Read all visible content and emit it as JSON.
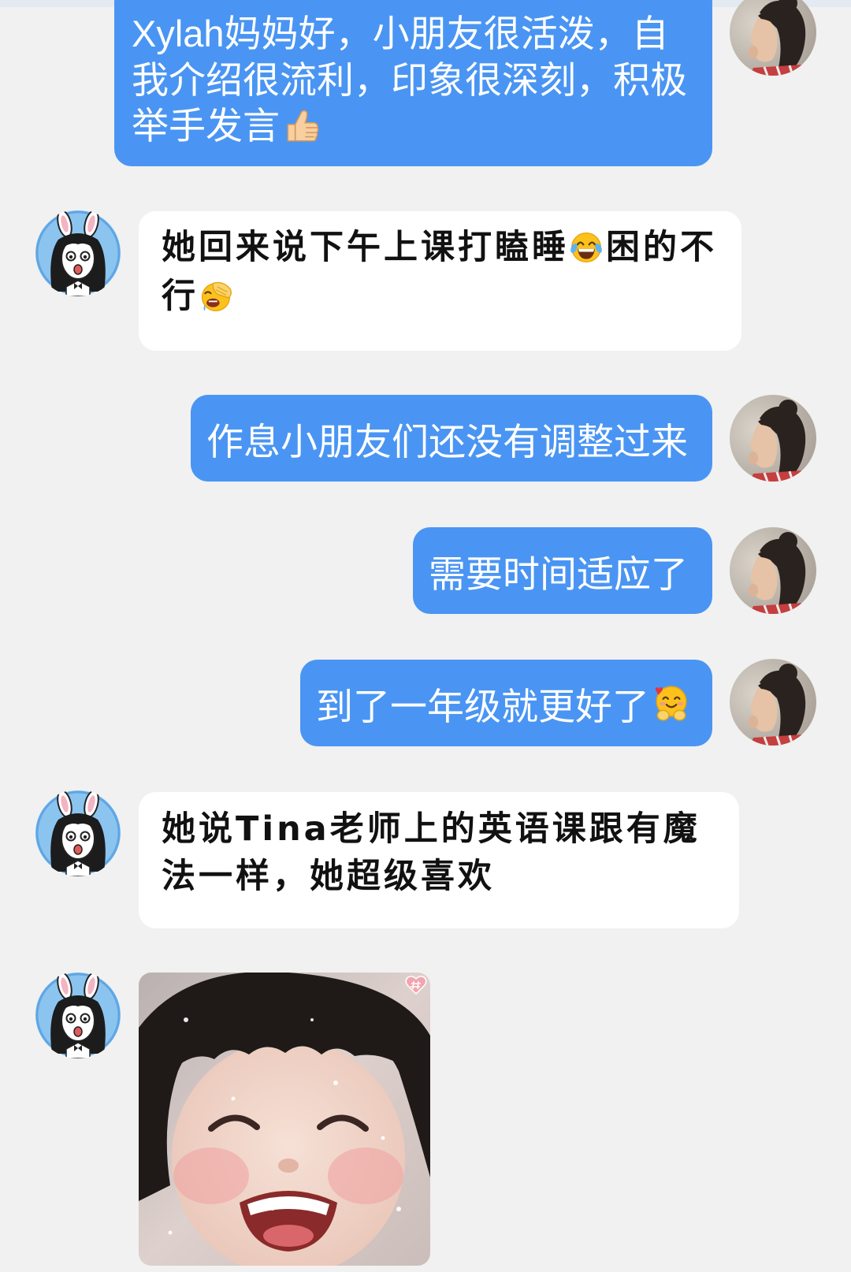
{
  "colors": {
    "page_background": "#f1f1f1",
    "outgoing_bubble": "#4a95f3",
    "incoming_bubble": "#ffffff",
    "outgoing_text": "#ffffff",
    "incoming_text": "#111111"
  },
  "messages": [
    {
      "avatar_icon": "child-photo-avatar-icon",
      "segments": [
        {
          "text": "Xylah妈妈好，小朋友很活泼，自我介绍很流利，印象很深刻，积极举手发言"
        },
        {
          "icon": "thumbs-up-icon"
        }
      ]
    },
    {
      "avatar_icon": "bunny-ears-girl-avatar-icon",
      "segments": [
        {
          "text": "她回来说下午上课打瞌睡"
        },
        {
          "icon": "tears-of-joy-icon"
        },
        {
          "text": "困的不行"
        },
        {
          "icon": "facepalm-icon"
        }
      ]
    },
    {
      "avatar_icon": "child-photo-avatar-icon",
      "segments": [
        {
          "text": "作息小朋友们还没有调整过来"
        }
      ]
    },
    {
      "avatar_icon": "child-photo-avatar-icon",
      "segments": [
        {
          "text": "需要时间适应了"
        }
      ]
    },
    {
      "avatar_icon": "child-photo-avatar-icon",
      "segments": [
        {
          "text": "到了一年级就更好了"
        },
        {
          "icon": "hugging-face-icon"
        }
      ]
    },
    {
      "avatar_icon": "bunny-ears-girl-avatar-icon",
      "segments": [
        {
          "text": "她说Tina老师上的英语课跟有魔法一样，她超级喜欢"
        }
      ]
    },
    {
      "avatar_icon": "bunny-ears-girl-avatar-icon",
      "image_icon": "smiling-baby-photo-icon",
      "badge_icon": "heart-sticker-badge-icon"
    }
  ]
}
